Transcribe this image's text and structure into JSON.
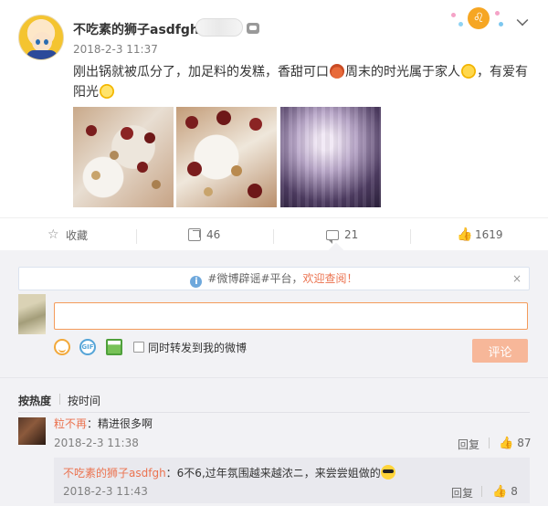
{
  "post": {
    "username": "不吃素的狮子asdfgh",
    "time": "2018-2-3 11:37",
    "text_part1": "刚出锅就被瓜分了，加足料的发糕，香甜可口",
    "text_part2": "周末的时光属于家人",
    "text_part3": "，有爱有阳光",
    "more_icon": "chevron-down-icon",
    "badge_icon": "member-badge-icon",
    "zodiac_icon": "leo-zodiac-icon",
    "photos": [
      "cake-photo-1",
      "cake-photo-2",
      "curtain-photo"
    ]
  },
  "actions": {
    "favorite_label": "收藏",
    "share_count": "46",
    "comment_count": "21",
    "like_count": "1619"
  },
  "comment_panel": {
    "notice_text_prefix": "#微博辟谣#平台，",
    "notice_text_highlight": "欢迎查阅！",
    "notice_close": "×",
    "input_value": "",
    "repost_label": "同时转发到我的微博",
    "submit_label": "评论"
  },
  "sort": {
    "hot": "按热度",
    "time": "按时间"
  },
  "comments": [
    {
      "name": "粒不再",
      "text": "：精进很多啊",
      "time": "2018-2-3 11:38",
      "reply_label": "回复",
      "likes": "87"
    }
  ],
  "sub_comment": {
    "name": "不吃素的狮子asdfgh",
    "text": "：6不6,过年氛围越来越浓ニ，来尝尝姐做的",
    "time": "2018-2-3 11:43",
    "reply_label": "回复",
    "likes": "8"
  },
  "colors": {
    "accent_orange": "#eb7350",
    "input_border": "#f49b5a",
    "submit_bg": "#f7b799",
    "panel_bg": "#f2f2f5"
  }
}
